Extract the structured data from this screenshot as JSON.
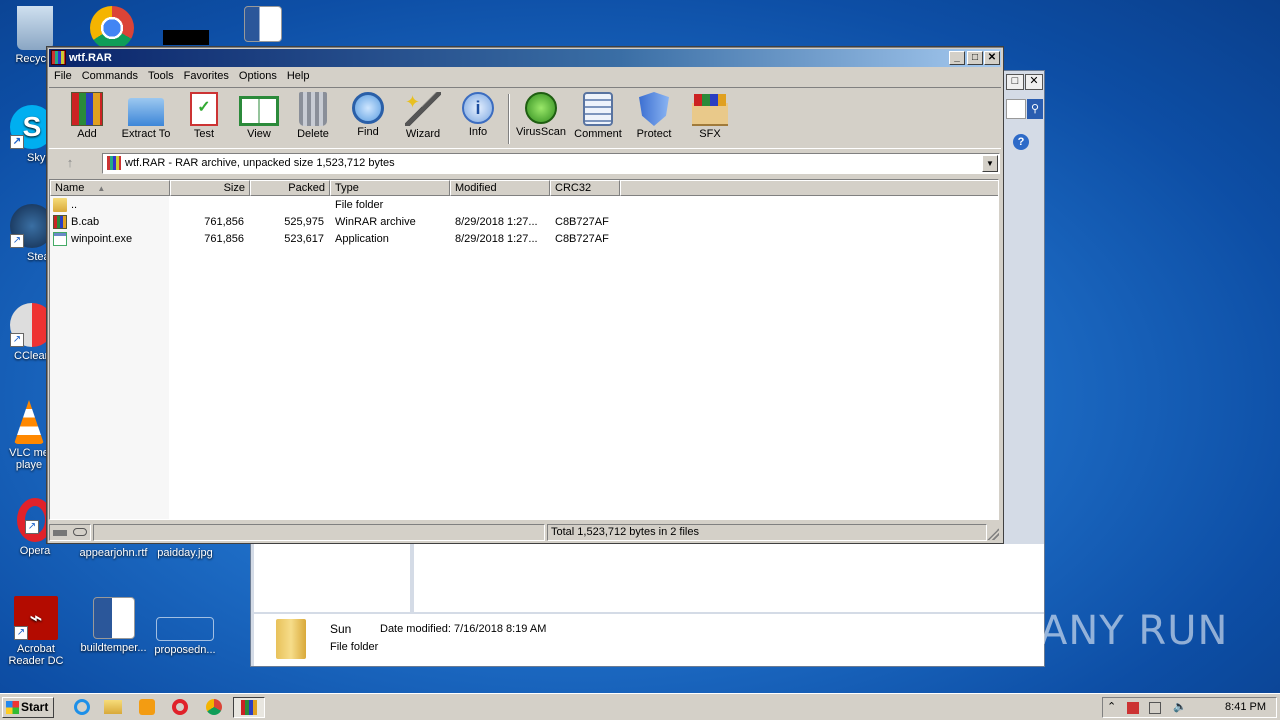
{
  "desktop": {
    "icons": [
      {
        "label": "Recycle",
        "name": "recycle-bin"
      },
      {
        "label": "Skyp",
        "name": "skype"
      },
      {
        "label": "Stea",
        "name": "steam"
      },
      {
        "label": "CClear",
        "name": "ccleaner"
      },
      {
        "label": "VLC me\nplaye",
        "name": "vlc"
      },
      {
        "label": "Opera",
        "name": "opera"
      },
      {
        "label": "Acrobat\nReader DC",
        "name": "acrobat"
      },
      {
        "label": "appearjohn.rtf",
        "name": "appearjohn"
      },
      {
        "label": "paidday.jpg",
        "name": "paidday"
      },
      {
        "label": "buildtemper...",
        "name": "buildtemper"
      },
      {
        "label": "proposedn...",
        "name": "proposedn"
      }
    ]
  },
  "explorer_bg": {
    "folder_name": "Sun",
    "date_modified_label": "Date modified:",
    "date_modified_value": "7/16/2018 8:19 AM",
    "type": "File folder"
  },
  "winrar": {
    "title": "wtf.RAR",
    "menu": [
      "File",
      "Commands",
      "Tools",
      "Favorites",
      "Options",
      "Help"
    ],
    "toolbar": [
      "Add",
      "Extract To",
      "Test",
      "View",
      "Delete",
      "Find",
      "Wizard",
      "Info",
      "VirusScan",
      "Comment",
      "Protect",
      "SFX"
    ],
    "address": "wtf.RAR - RAR archive, unpacked size 1,523,712 bytes",
    "columns": [
      "Name",
      "Size",
      "Packed",
      "Type",
      "Modified",
      "CRC32"
    ],
    "rows": [
      {
        "name": "..",
        "size": "",
        "packed": "",
        "type": "File folder",
        "modified": "",
        "crc": ""
      },
      {
        "name": "B.cab",
        "size": "761,856",
        "packed": "525,975",
        "type": "WinRAR archive",
        "modified": "8/29/2018 1:27...",
        "crc": "C8B727AF"
      },
      {
        "name": "winpoint.exe",
        "size": "761,856",
        "packed": "523,617",
        "type": "Application",
        "modified": "8/29/2018 1:27...",
        "crc": "C8B727AF"
      }
    ],
    "status": "Total 1,523,712 bytes in 2 files"
  },
  "taskbar": {
    "start": "Start",
    "clock": "8:41 PM"
  },
  "watermark": "ANY RUN"
}
